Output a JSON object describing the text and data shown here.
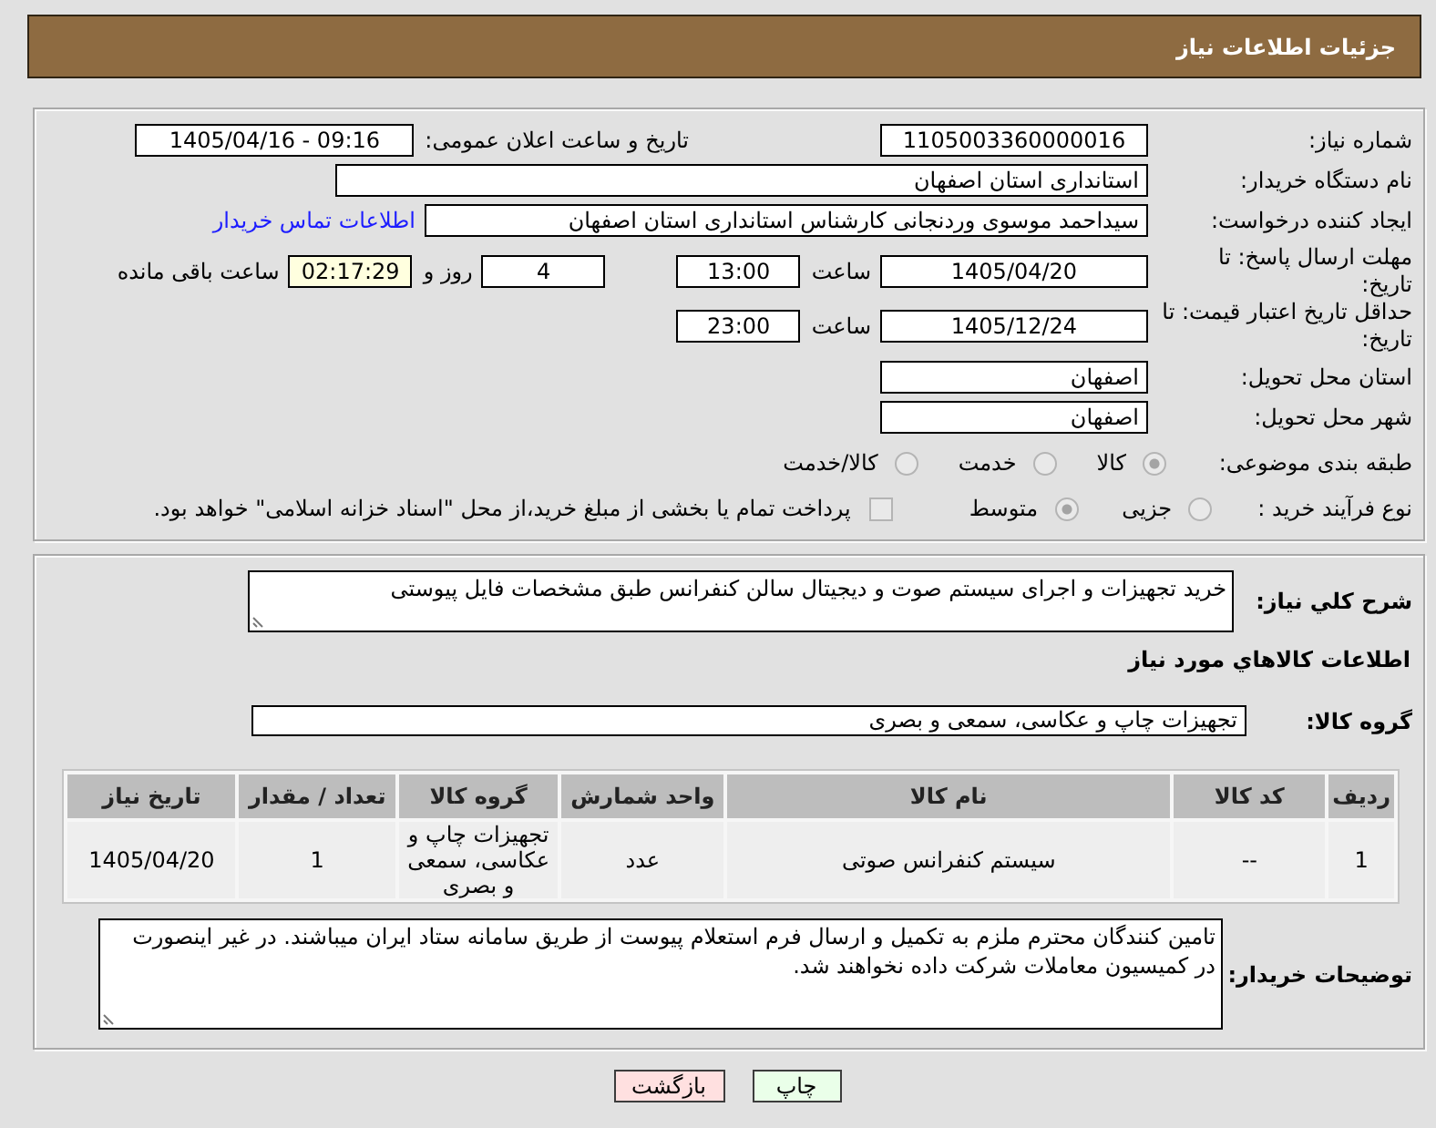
{
  "header": {
    "title": "جزئیات اطلاعات نیاز"
  },
  "info": {
    "need_number": {
      "label": "شماره نیاز:",
      "value": "1105003360000016"
    },
    "announced": {
      "label": "تاریخ و ساعت اعلان عمومی:",
      "value": "1405/04/16 - 09:16"
    },
    "buyer": {
      "label": "نام دستگاه خریدار:",
      "value": "استانداری استان اصفهان"
    },
    "requester": {
      "label": "ایجاد کننده درخواست:",
      "value": "سیداحمد موسوی وردنجانی کارشناس استانداری استان اصفهان",
      "contact_link": "اطلاعات تماس خریدار"
    },
    "reply_deadline": {
      "label": "مهلت ارسال پاسخ: تا تاریخ:",
      "date": "1405/04/20",
      "time_label": "ساعت",
      "time": "13:00",
      "days": "4",
      "days_label": "روز و",
      "remaining": "02:17:29",
      "remaining_label": "ساعت باقی مانده"
    },
    "price_validity": {
      "label": "حداقل تاریخ اعتبار قیمت: تا تاریخ:",
      "date": "1405/12/24",
      "time_label": "ساعت",
      "time": "23:00"
    },
    "delivery_province": {
      "label": "استان محل تحویل:",
      "value": "اصفهان"
    },
    "delivery_city": {
      "label": "شهر محل تحویل:",
      "value": "اصفهان"
    },
    "subject_class": {
      "label": "طبقه بندی موضوعی:",
      "options": [
        {
          "label": "کالا",
          "selected": true,
          "disabled": true
        },
        {
          "label": "خدمت",
          "selected": false,
          "disabled": true
        },
        {
          "label": "کالا/خدمت",
          "selected": false,
          "disabled": true
        }
      ]
    },
    "purchase_type": {
      "label": "نوع فرآیند خرید :",
      "options": [
        {
          "label": "جزیی",
          "selected": false,
          "disabled": true
        },
        {
          "label": "متوسط",
          "selected": true,
          "disabled": true
        }
      ],
      "treasury_payment": {
        "label": "پرداخت تمام یا بخشی از مبلغ خرید،از محل \"اسناد خزانه اسلامی\" خواهد بود.",
        "checked": false,
        "disabled": true
      }
    }
  },
  "need": {
    "description": {
      "label": "شرح کلي نياز:",
      "value": "خرید تجهیزات و اجرای سیستم صوت و دیجیتال سالن کنفرانس طبق مشخصات فایل پیوستی"
    },
    "goods_title": "اطلاعات کالاهاي مورد نياز",
    "goods_group": {
      "label": "گروه کالا:",
      "value": "تجهیزات چاپ و عکاسی، سمعی و بصری"
    },
    "table": {
      "columns": [
        "ردیف",
        "کد کالا",
        "نام کالا",
        "واحد شمارش",
        "گروه کالا",
        "تعداد / مقدار",
        "تاریخ نیاز"
      ],
      "rows": [
        [
          "1",
          "--",
          "سیستم کنفرانس صوتی",
          "عدد",
          "تجهیزات چاپ و عکاسی، سمعی و بصری",
          "1",
          "1405/04/20"
        ]
      ]
    },
    "buyer_notes": {
      "label": "توضیحات خریدار:",
      "value": "تامین کنندگان محترم ملزم به تکمیل و ارسال فرم استعلام پیوست از طریق سامانه ستاد ایران میباشند. در غیر اینصورت در کمیسیون معاملات شرکت داده نخواهند شد."
    }
  },
  "buttons": [
    {
      "label": "چاپ",
      "kind": "print"
    },
    {
      "label": "بازگشت",
      "kind": "back"
    }
  ]
}
